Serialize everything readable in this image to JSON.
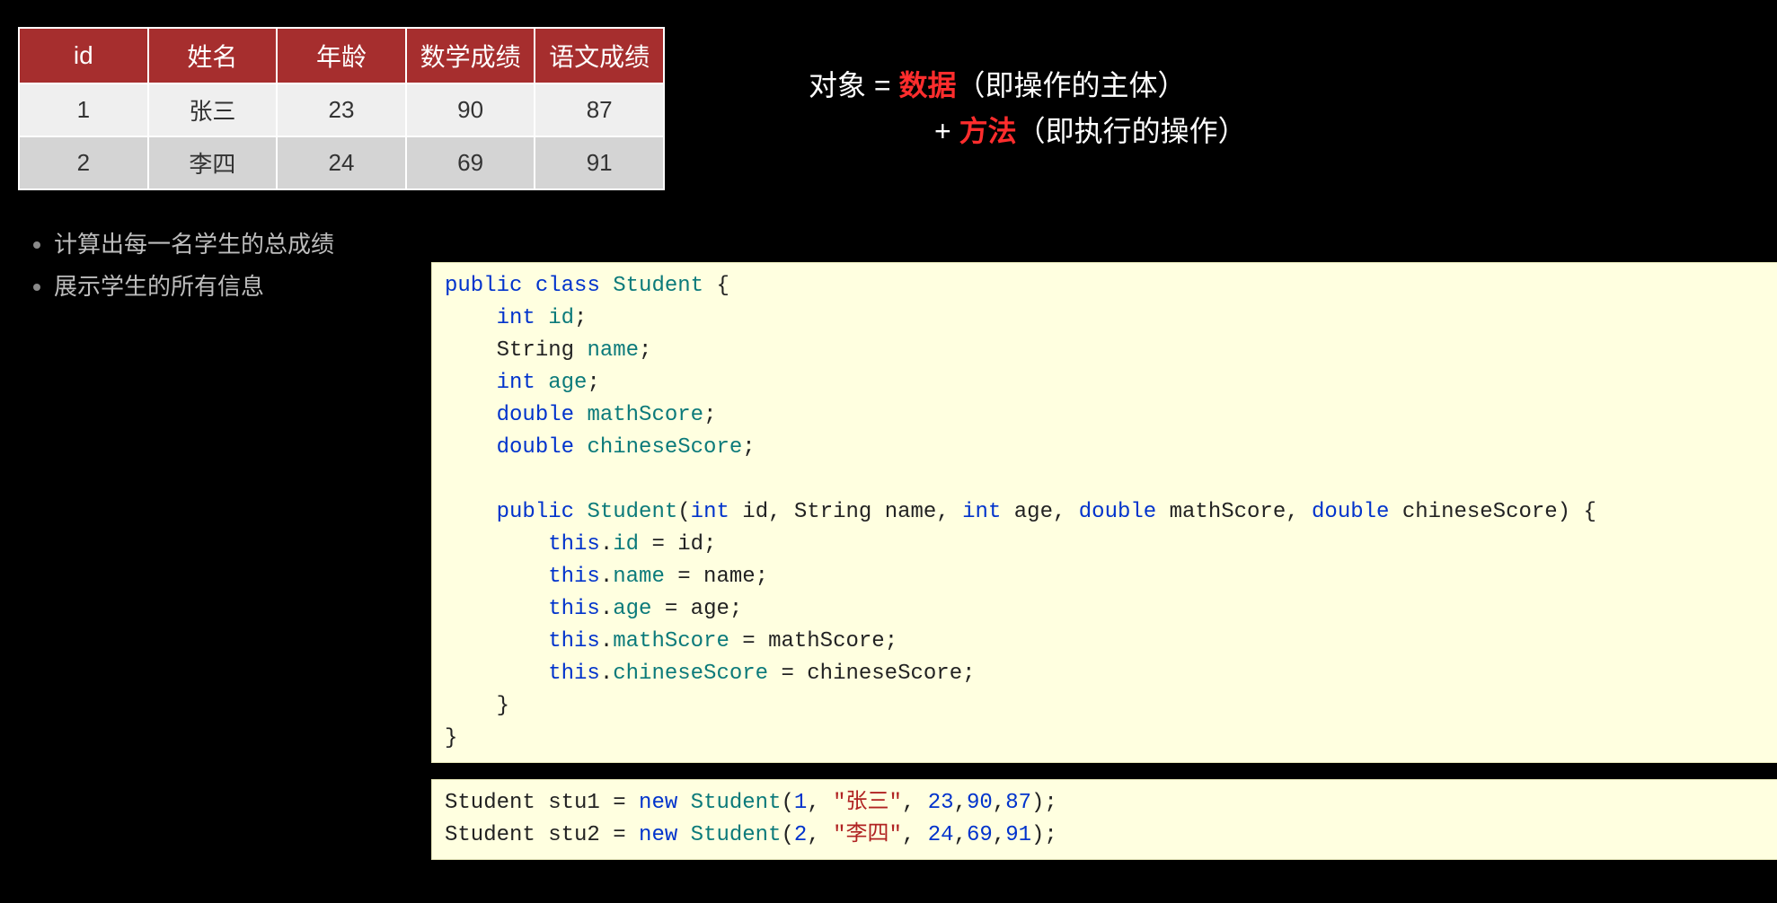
{
  "table": {
    "headers": [
      "id",
      "姓名",
      "年龄",
      "数学成绩",
      "语文成绩"
    ],
    "rows": [
      [
        "1",
        "张三",
        "23",
        "90",
        "87"
      ],
      [
        "2",
        "李四",
        "24",
        "69",
        "91"
      ]
    ]
  },
  "notes": {
    "line1_pre": "对象 = ",
    "line1_hl": "数据",
    "line1_post": "（即操作的主体）",
    "line2_pre": "+ ",
    "line2_hl": "方法",
    "line2_post": "（即执行的操作）"
  },
  "tasks": [
    "计算出每一名学生的总成绩",
    "展示学生的所有信息"
  ],
  "code_main": {
    "l1_a": "public",
    "l1_b": " ",
    "l1_c": "class",
    "l1_d": " ",
    "l1_e": "Student",
    "l1_f": " {",
    "l2_a": "    ",
    "l2_b": "int",
    "l2_c": " ",
    "l2_d": "id",
    "l2_e": ";",
    "l3_a": "    String ",
    "l3_b": "name",
    "l3_c": ";",
    "l4_a": "    ",
    "l4_b": "int",
    "l4_c": " ",
    "l4_d": "age",
    "l4_e": ";",
    "l5_a": "    ",
    "l5_b": "double",
    "l5_c": " ",
    "l5_d": "mathScore",
    "l5_e": ";",
    "l6_a": "    ",
    "l6_b": "double",
    "l6_c": " ",
    "l6_d": "chineseScore",
    "l6_e": ";",
    "l7": "",
    "l8_a": "    ",
    "l8_b": "public",
    "l8_c": " ",
    "l8_d": "Student",
    "l8_e": "(",
    "l8_f": "int",
    "l8_g": " id, String name, ",
    "l8_h": "int",
    "l8_i": " age, ",
    "l8_j": "double",
    "l8_k": " mathScore, ",
    "l8_l": "double",
    "l8_m": " chineseScore) {",
    "l9_a": "        ",
    "l9_b": "this",
    "l9_c": ".",
    "l9_d": "id",
    "l9_e": " = id;",
    "l10_a": "        ",
    "l10_b": "this",
    "l10_c": ".",
    "l10_d": "name",
    "l10_e": " = name;",
    "l11_a": "        ",
    "l11_b": "this",
    "l11_c": ".",
    "l11_d": "age",
    "l11_e": " = age;",
    "l12_a": "        ",
    "l12_b": "this",
    "l12_c": ".",
    "l12_d": "mathScore",
    "l12_e": " = mathScore;",
    "l13_a": "        ",
    "l13_b": "this",
    "l13_c": ".",
    "l13_d": "chineseScore",
    "l13_e": " = chineseScore;",
    "l14": "    }",
    "l15": "}"
  },
  "code_use": {
    "l1_a": "Student stu1 = ",
    "l1_b": "new",
    "l1_c": " ",
    "l1_d": "Student",
    "l1_e": "(",
    "l1_f": "1",
    "l1_g": ", ",
    "l1_h": "\"张三\"",
    "l1_i": ", ",
    "l1_j": "23",
    "l1_k": ",",
    "l1_l": "90",
    "l1_m": ",",
    "l1_n": "87",
    "l1_o": ");",
    "l2_a": "Student stu2 = ",
    "l2_b": "new",
    "l2_c": " ",
    "l2_d": "Student",
    "l2_e": "(",
    "l2_f": "2",
    "l2_g": ", ",
    "l2_h": "\"李四\"",
    "l2_i": ", ",
    "l2_j": "24",
    "l2_k": ",",
    "l2_l": "69",
    "l2_m": ",",
    "l2_n": "91",
    "l2_o": ");"
  }
}
